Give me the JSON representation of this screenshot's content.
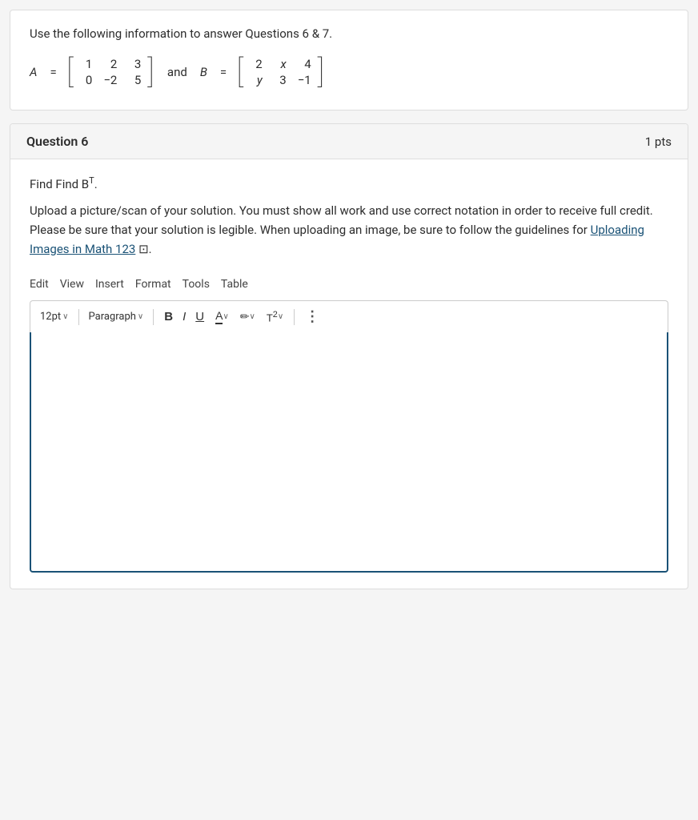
{
  "info": {
    "instruction": "Use the following information to answer Questions 6 & 7.",
    "matrix_a_label": "A",
    "matrix_b_label": "B",
    "and_text": "and",
    "equals": "=",
    "matrix_a": {
      "rows": [
        [
          "1",
          "2",
          "3"
        ],
        [
          "0",
          "−2",
          "5"
        ]
      ]
    },
    "matrix_b": {
      "rows": [
        [
          "2",
          "x",
          "4"
        ],
        [
          "y",
          "3",
          "−1"
        ]
      ]
    }
  },
  "question": {
    "title": "Question 6",
    "pts": "1 pts",
    "find_label": "Find B",
    "find_superscript": "T",
    "find_period": ".",
    "instructions": "Upload a picture/scan of your solution. You must show all work and use correct notation in order to receive full credit. Please be sure that your solution is legible. When uploading an image, be sure to follow the guidelines for",
    "link_text": "Uploading Images in Math 123",
    "instructions_end": "."
  },
  "editor": {
    "menubar": {
      "edit": "Edit",
      "view": "View",
      "insert": "Insert",
      "format": "Format",
      "tools": "Tools",
      "table": "Table"
    },
    "toolbar": {
      "font_size": "12pt",
      "paragraph": "Paragraph",
      "bold": "B",
      "italic": "I",
      "underline": "U",
      "font_color": "A",
      "highlight": "✏",
      "superscript": "T²",
      "more": "⋮"
    },
    "placeholder": ""
  }
}
